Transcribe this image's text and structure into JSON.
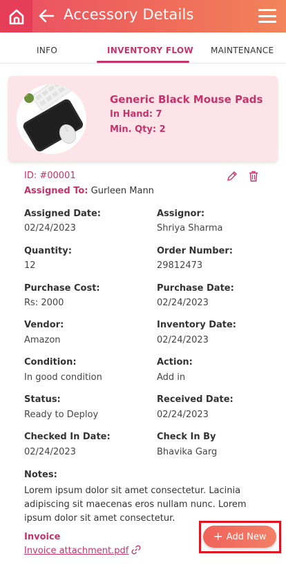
{
  "header": {
    "title": "Accessory Details",
    "home_icon": "home-icon",
    "back_icon": "arrow-left-icon",
    "menu_icon": "hamburger-menu-icon"
  },
  "tabs": [
    {
      "label": "INFO",
      "active": false
    },
    {
      "label": "INVENTORY FLOW",
      "active": true
    },
    {
      "label": "MAINTENANCE",
      "active": false
    }
  ],
  "item": {
    "name": "Generic Black Mouse Pads",
    "in_hand": "In Hand: 7",
    "min_qty": "Min. Qty: 2"
  },
  "record": {
    "id": "ID: #00001",
    "assigned_to_label": "Assigned To:",
    "assigned_to_value": "Gurleen Mann",
    "fields": [
      {
        "label": "Assigned Date:",
        "value": "02/24/2023"
      },
      {
        "label": "Assignor:",
        "value": "Shriya Sharma"
      },
      {
        "label": "Quantity:",
        "value": "12"
      },
      {
        "label": "Order Number:",
        "value": "29812473"
      },
      {
        "label": "Purchase Cost:",
        "value": "Rs: 2000"
      },
      {
        "label": "Purchase Date:",
        "value": "02/24/2023"
      },
      {
        "label": "Vendor:",
        "value": "Amazon"
      },
      {
        "label": "Inventory Date:",
        "value": "02/24/2023"
      },
      {
        "label": "Condition:",
        "value": "In good condition"
      },
      {
        "label": "Action:",
        "value": "Add in"
      },
      {
        "label": "Status:",
        "value": "Ready to Deploy"
      },
      {
        "label": "Received Date:",
        "value": "02/24/2023"
      },
      {
        "label": "Checked In Date:",
        "value": "02/24/2023"
      },
      {
        "label": "Check In By",
        "value": "Bhavika Garg"
      }
    ],
    "notes_label": "Notes:",
    "notes": "Lorem ipsum dolor sit amet consectetur. Lacinia adipiscing sit maecenas eros nullam nunc. Lorem ipsum dolor sit amet consectetur.",
    "invoice_label": "Invoice",
    "invoice_file": "Invoice attachment.pdf"
  },
  "actions": {
    "add_new": "Add New"
  },
  "colors": {
    "accent": "#c4336a",
    "header_start": "#ea4e63",
    "header_end": "#f2845a",
    "card_bg": "#fce4e9",
    "highlight": "#e0141e"
  }
}
